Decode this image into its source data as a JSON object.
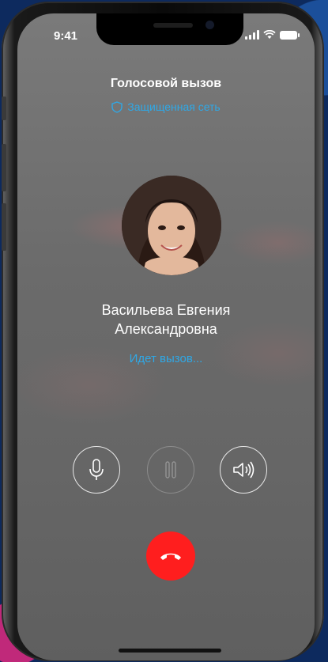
{
  "status_bar": {
    "time": "9:41"
  },
  "call": {
    "title": "Голосовой вызов",
    "secure_label": "Защищенная сеть",
    "caller_name_line1": "Васильева Евгения",
    "caller_name_line2": "Александровна",
    "status": "Идет вызов..."
  },
  "controls": [
    {
      "name": "mute",
      "icon": "microphone-icon",
      "enabled": true
    },
    {
      "name": "hold",
      "icon": "pause-icon",
      "enabled": false
    },
    {
      "name": "speaker",
      "icon": "speaker-icon",
      "enabled": true
    }
  ],
  "end_call": {
    "icon": "phone-hangup-icon",
    "color": "#ff1e1e"
  },
  "colors": {
    "accent": "#2fa8e6",
    "background": "#6b6b6b"
  }
}
